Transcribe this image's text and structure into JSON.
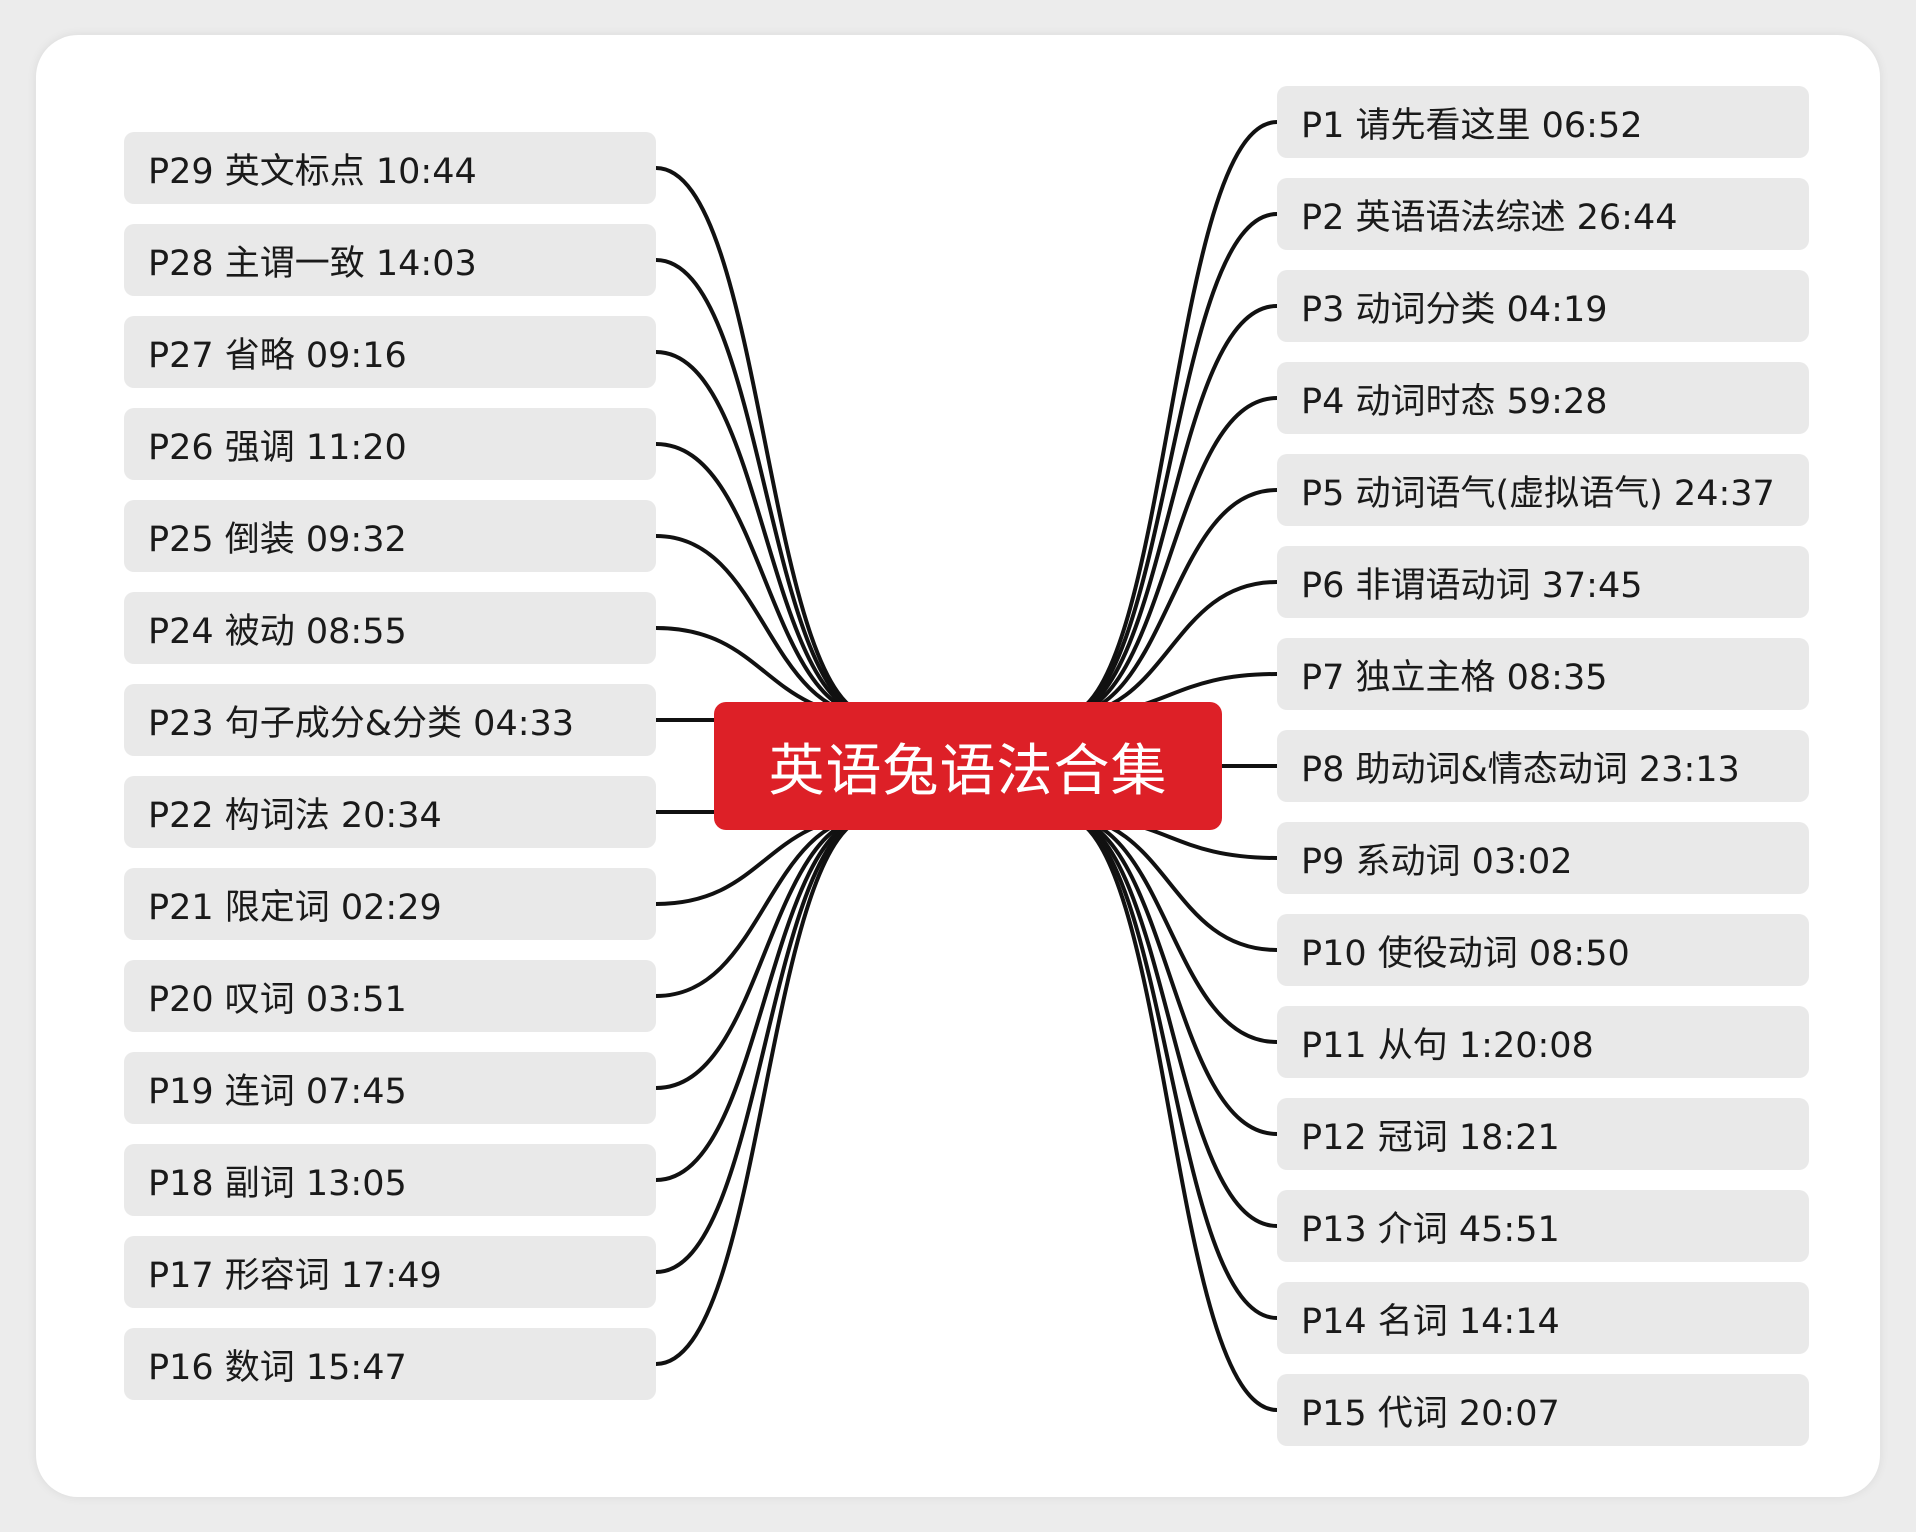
{
  "center": {
    "title": "英语兔语法合集",
    "color": "#dd2027"
  },
  "colors": {
    "node_fill": "#e9e9e9",
    "link": "#111111",
    "background": "#ffffff"
  },
  "right_nodes": [
    "P1 请先看这里 06:52",
    "P2 英语语法综述  26:44",
    "P3 动词分类 04:19",
    "P4 动词时态 59:28",
    "P5 动词语气(虚拟语气) 24:37",
    "P6 非谓语动词 37:45",
    "P7 独立主格 08:35",
    "P8 助动词&情态动词 23:13",
    "P9 系动词 03:02",
    "P10 使役动词 08:50",
    "P11 从句 1:20:08",
    "P12 冠词 18:21",
    "P13 介词 45:51",
    "P14 名词 14:14",
    "P15 代词 20:07"
  ],
  "left_nodes": [
    "P29 英文标点 10:44",
    "P28 主谓一致 14:03",
    "P27 省略 09:16",
    "P26 强调 11:20",
    "P25 倒装 09:32",
    "P24 被动 08:55",
    "P23 句子成分&分类 04:33",
    "P22 构词法 20:34",
    "P21 限定词 02:29",
    "P20 叹词 03:51",
    "P19 连词 07:45",
    "P18 副词 13:05",
    "P17 形容词 17:49",
    "P16 数词 15:47"
  ]
}
